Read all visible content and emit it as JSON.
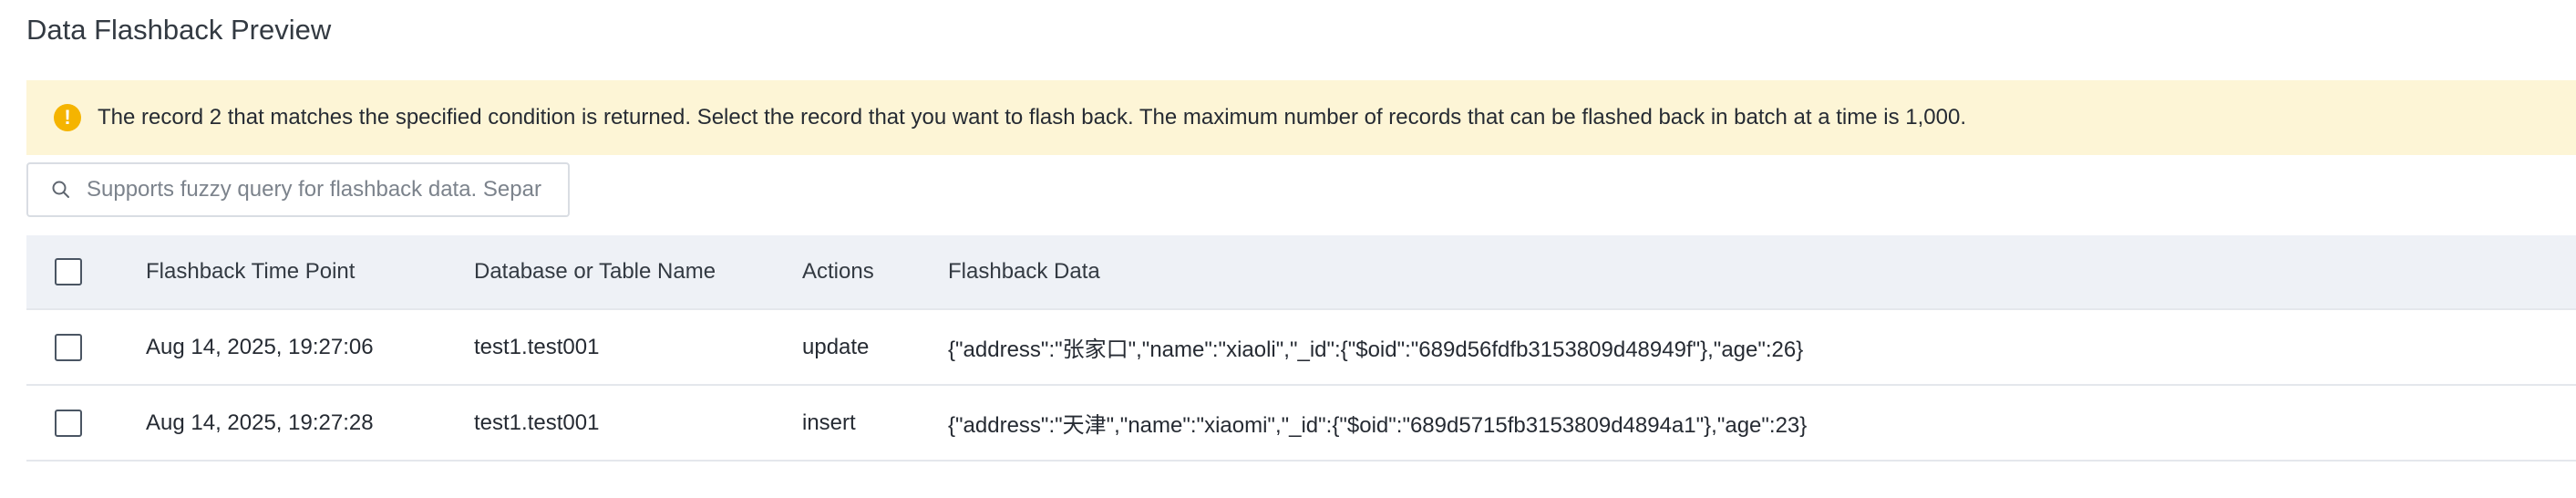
{
  "page": {
    "title": "Data Flashback Preview"
  },
  "notice": {
    "icon": "warning-icon",
    "color": "#f5b400",
    "background": "#fdf5d6",
    "text": "The record 2 that matches the specified condition is returned. Select the record that you want to flash back. The maximum number of records that can be flashed back in batch at a time is 1,000."
  },
  "search": {
    "icon": "search-icon",
    "placeholder": "Supports fuzzy query for flashback data. Separate multiple keywords with commas.",
    "value": ""
  },
  "table": {
    "columns": {
      "select_all": "",
      "time": "Flashback Time Point",
      "db": "Database or Table Name",
      "action": "Actions",
      "data": "Flashback Data"
    },
    "rows": [
      {
        "checked": false,
        "time": "Aug 14, 2025, 19:27:06",
        "db": "test1.test001",
        "action": "update",
        "data": "{\"address\":\"张家口\",\"name\":\"xiaoli\",\"_id\":{\"$oid\":\"689d56fdfb3153809d48949f\"},\"age\":26}"
      },
      {
        "checked": false,
        "time": "Aug 14, 2025, 19:27:28",
        "db": "test1.test001",
        "action": "insert",
        "data": "{\"address\":\"天津\",\"name\":\"xiaomi\",\"_id\":{\"$oid\":\"689d5715fb3153809d4894a1\"},\"age\":23}"
      }
    ]
  }
}
